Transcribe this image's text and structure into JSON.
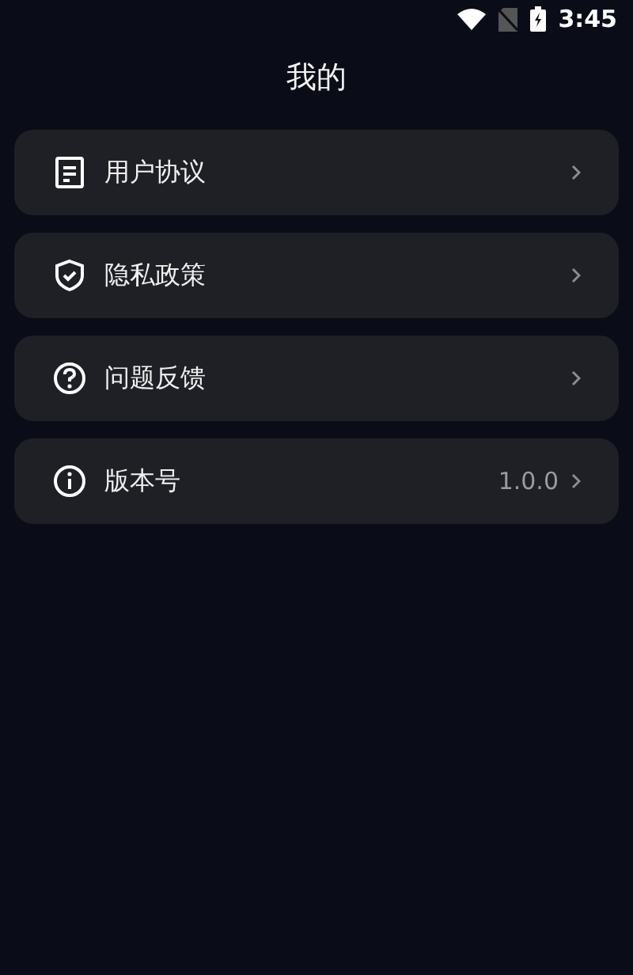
{
  "status_bar": {
    "time": "3:45"
  },
  "title": "我的",
  "items": [
    {
      "kind": "document",
      "label": "用户协议"
    },
    {
      "kind": "shield",
      "label": "隐私政策"
    },
    {
      "kind": "question",
      "label": "问题反馈"
    },
    {
      "kind": "info",
      "label": "版本号",
      "value": "1.0.0"
    }
  ]
}
